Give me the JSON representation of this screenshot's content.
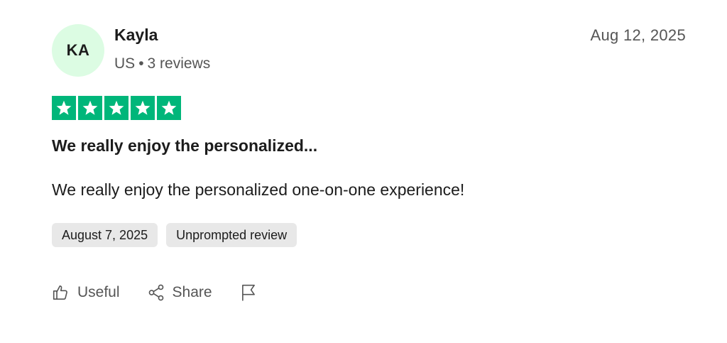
{
  "reviewer": {
    "initials": "KA",
    "name": "Kayla",
    "country": "US",
    "separator": "•",
    "review_count": "3 reviews",
    "avatar_color": "#dcfce3"
  },
  "review": {
    "date": "Aug 12, 2025",
    "rating": 5,
    "max_rating": 5,
    "star_color": "#00b67a",
    "title": "We really enjoy the personalized...",
    "body": "We really enjoy the personalized one-on-one experience!",
    "experience_date": "August 7, 2025",
    "tag": "Unprompted review"
  },
  "actions": {
    "useful_label": "Useful",
    "useful_icon": "thumbs-up-icon",
    "share_label": "Share",
    "share_icon": "share-icon",
    "report_icon": "flag-icon"
  }
}
